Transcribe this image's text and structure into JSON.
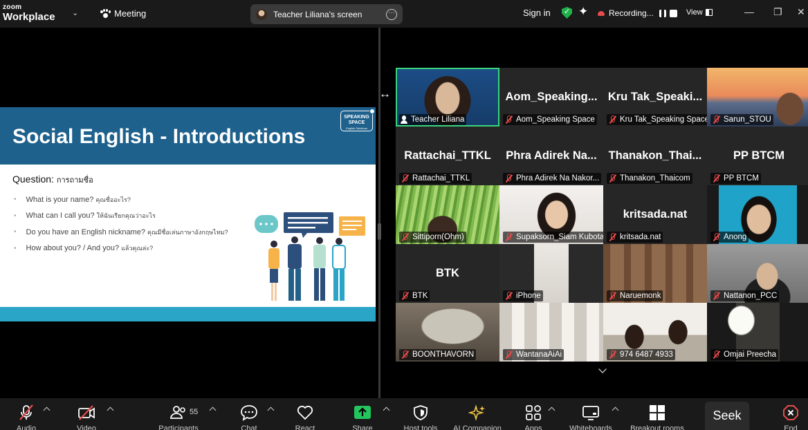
{
  "app": {
    "brand_top": "zoom",
    "brand_bottom": "Workplace",
    "meeting_label": "Meeting"
  },
  "screen_share": {
    "title": "Teacher Liliana's screen",
    "options_icon": "more-icon"
  },
  "header_right": {
    "sign_in": "Sign in",
    "recording_label": "Recording...",
    "view_label": "View",
    "encryption_icon": "shield-check-icon",
    "ai_icon": "sparkle-icon"
  },
  "slide": {
    "title": "Social English - Introductions",
    "logo_line1": "SPEAKING",
    "logo_line2": "SPACE",
    "logo_sub": "English Solutions",
    "question_label": "Question:",
    "question_thai": "การถามชื่อ",
    "bullets": [
      {
        "en": "What is your name?",
        "th": "คุณชื่ออะไร?"
      },
      {
        "en": "What can I call you?",
        "th": "ให้ฉันเรียกคุณว่าอะไร"
      },
      {
        "en": "Do you have an English nickname?",
        "th": "คุณมีชื่อเล่นภาษาอังกฤษไหม?"
      },
      {
        "en": "How about you? / And you?",
        "th": "แล้วคุณล่ะ?"
      }
    ]
  },
  "participants": [
    {
      "name": "Teacher Liliana",
      "title": "",
      "muted": false
    },
    {
      "name": "Aom_Speaking Space",
      "title": "Aom_Speaking...",
      "muted": true
    },
    {
      "name": "Kru Tak_Speaking Space",
      "title": "Kru Tak_Speaki...",
      "muted": true
    },
    {
      "name": "Sarun_STOU",
      "title": "",
      "muted": true
    },
    {
      "name": "Rattachai_TTKL",
      "title": "Rattachai_TTKL",
      "muted": true
    },
    {
      "name": "Phra Adirek Na Nakor...",
      "title": "Phra Adirek Na...",
      "muted": true
    },
    {
      "name": "Thanakon_Thaicom",
      "title": "Thanakon_Thai...",
      "muted": true
    },
    {
      "name": "PP BTCM",
      "title": "PP BTCM",
      "muted": true
    },
    {
      "name": "Sittiporn(Ohm)",
      "title": "",
      "muted": true
    },
    {
      "name": "Supaksorn_Siam Kubota",
      "title": "",
      "muted": true
    },
    {
      "name": "kritsada.nat",
      "title": "kritsada.nat",
      "muted": true
    },
    {
      "name": "Anong",
      "title": "",
      "muted": true
    },
    {
      "name": "BTK",
      "title": "BTK",
      "muted": true
    },
    {
      "name": "iPhone",
      "title": "",
      "muted": true
    },
    {
      "name": "Naruemonk",
      "title": "",
      "muted": true
    },
    {
      "name": "Nattanon_PCC",
      "title": "",
      "muted": true
    },
    {
      "name": "BOONTHAVORN",
      "title": "",
      "muted": true
    },
    {
      "name": "WantanaAiAi",
      "title": "",
      "muted": true
    },
    {
      "name": "974 6487 4933",
      "title": "",
      "muted": true
    },
    {
      "name": "Omjai Preecha",
      "title": "",
      "muted": true
    }
  ],
  "toolbar": {
    "audio": "Audio",
    "video": "Video",
    "participants": "Participants",
    "participant_count": "55",
    "chat": "Chat",
    "react": "React",
    "share": "Share",
    "host_tools": "Host tools",
    "ai_companion": "AI Companion",
    "apps": "Apps",
    "whiteboards": "Whiteboards",
    "breakout_rooms": "Breakout rooms",
    "end": "End",
    "seek": "Seek"
  },
  "colors": {
    "slide_header": "#1f618d",
    "slide_footer": "#2aa5c8",
    "active_speaker": "#3ad67a",
    "muted": "#e74c4c",
    "share_green": "#22c55e"
  }
}
